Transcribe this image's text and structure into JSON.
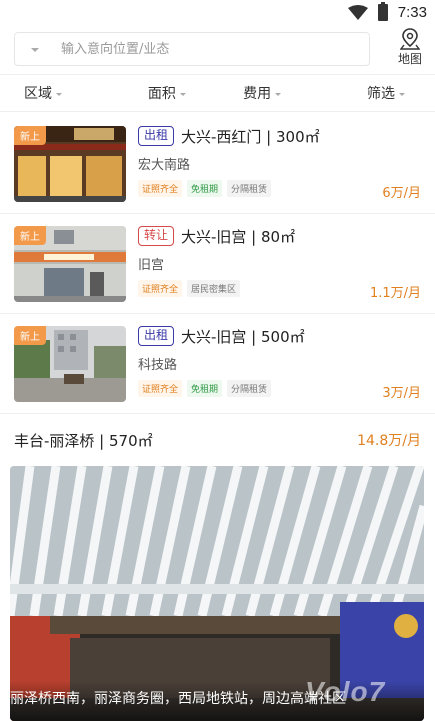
{
  "status_bar": {
    "time": "7:33"
  },
  "search": {
    "placeholder": "输入意向位置/业态"
  },
  "map_button": {
    "label": "地图"
  },
  "filters": [
    {
      "label": "区域"
    },
    {
      "label": "面积"
    },
    {
      "label": "费用"
    },
    {
      "label": "筛选"
    }
  ],
  "listings": [
    {
      "new_tag": "新上",
      "type": "出租",
      "title": "大兴-西红门 | 300㎡",
      "subtitle": "宏大南路",
      "tags": [
        "证照齐全",
        "免租期",
        "分隔租赁"
      ],
      "price": "6万/月"
    },
    {
      "new_tag": "新上",
      "type": "转让",
      "title": "大兴-旧宫 | 80㎡",
      "subtitle": "旧宫",
      "tags": [
        "证照齐全",
        "居民密集区"
      ],
      "price": "1.1万/月"
    },
    {
      "new_tag": "新上",
      "type": "出租",
      "title": "大兴-旧宫 | 500㎡",
      "subtitle": "科技路",
      "tags": [
        "证照齐全",
        "免租期",
        "分隔租赁"
      ],
      "price": "3万/月"
    }
  ],
  "featured": {
    "title": "丰台-丽泽桥 | 570㎡",
    "price": "14.8万/月",
    "caption": "丽泽桥西南，丽泽商务圈，西局地铁站，周边高端社区"
  },
  "watermark": "Volo7"
}
